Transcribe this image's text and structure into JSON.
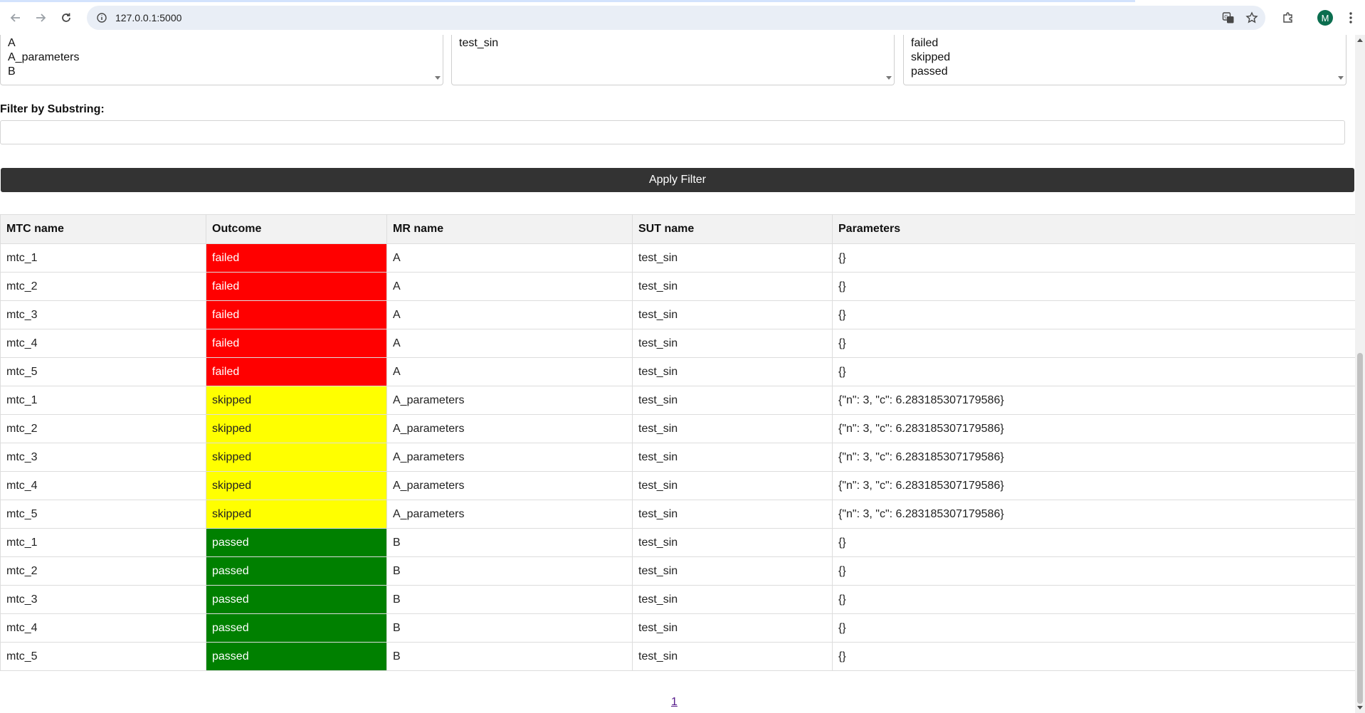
{
  "browser": {
    "url": "127.0.0.1:5000",
    "avatar_letter": "M"
  },
  "filters": {
    "mr_options": [
      "A",
      "A_parameters",
      "B"
    ],
    "sut_options": [
      "test_sin"
    ],
    "outcome_options": [
      "failed",
      "skipped",
      "passed"
    ],
    "substring_label": "Filter by Substring:",
    "substring_value": "",
    "apply_label": "Apply Filter"
  },
  "table": {
    "headers": [
      "MTC name",
      "Outcome",
      "MR name",
      "SUT name",
      "Parameters"
    ],
    "outcome_colors": {
      "failed": "#ff0000",
      "skipped": "#ffff00",
      "passed": "#008000"
    },
    "outcome_text_colors": {
      "failed": "#ffffff",
      "skipped": "#222222",
      "passed": "#ffffff"
    },
    "rows": [
      {
        "mtc": "mtc_1",
        "outcome": "failed",
        "mr": "A",
        "sut": "test_sin",
        "params": "{}"
      },
      {
        "mtc": "mtc_2",
        "outcome": "failed",
        "mr": "A",
        "sut": "test_sin",
        "params": "{}"
      },
      {
        "mtc": "mtc_3",
        "outcome": "failed",
        "mr": "A",
        "sut": "test_sin",
        "params": "{}"
      },
      {
        "mtc": "mtc_4",
        "outcome": "failed",
        "mr": "A",
        "sut": "test_sin",
        "params": "{}"
      },
      {
        "mtc": "mtc_5",
        "outcome": "failed",
        "mr": "A",
        "sut": "test_sin",
        "params": "{}"
      },
      {
        "mtc": "mtc_1",
        "outcome": "skipped",
        "mr": "A_parameters",
        "sut": "test_sin",
        "params": "{\"n\": 3, \"c\": 6.283185307179586}"
      },
      {
        "mtc": "mtc_2",
        "outcome": "skipped",
        "mr": "A_parameters",
        "sut": "test_sin",
        "params": "{\"n\": 3, \"c\": 6.283185307179586}"
      },
      {
        "mtc": "mtc_3",
        "outcome": "skipped",
        "mr": "A_parameters",
        "sut": "test_sin",
        "params": "{\"n\": 3, \"c\": 6.283185307179586}"
      },
      {
        "mtc": "mtc_4",
        "outcome": "skipped",
        "mr": "A_parameters",
        "sut": "test_sin",
        "params": "{\"n\": 3, \"c\": 6.283185307179586}"
      },
      {
        "mtc": "mtc_5",
        "outcome": "skipped",
        "mr": "A_parameters",
        "sut": "test_sin",
        "params": "{\"n\": 3, \"c\": 6.283185307179586}"
      },
      {
        "mtc": "mtc_1",
        "outcome": "passed",
        "mr": "B",
        "sut": "test_sin",
        "params": "{}"
      },
      {
        "mtc": "mtc_2",
        "outcome": "passed",
        "mr": "B",
        "sut": "test_sin",
        "params": "{}"
      },
      {
        "mtc": "mtc_3",
        "outcome": "passed",
        "mr": "B",
        "sut": "test_sin",
        "params": "{}"
      },
      {
        "mtc": "mtc_4",
        "outcome": "passed",
        "mr": "B",
        "sut": "test_sin",
        "params": "{}"
      },
      {
        "mtc": "mtc_5",
        "outcome": "passed",
        "mr": "B",
        "sut": "test_sin",
        "params": "{}"
      }
    ]
  },
  "pagination": {
    "pages": [
      "1"
    ]
  }
}
